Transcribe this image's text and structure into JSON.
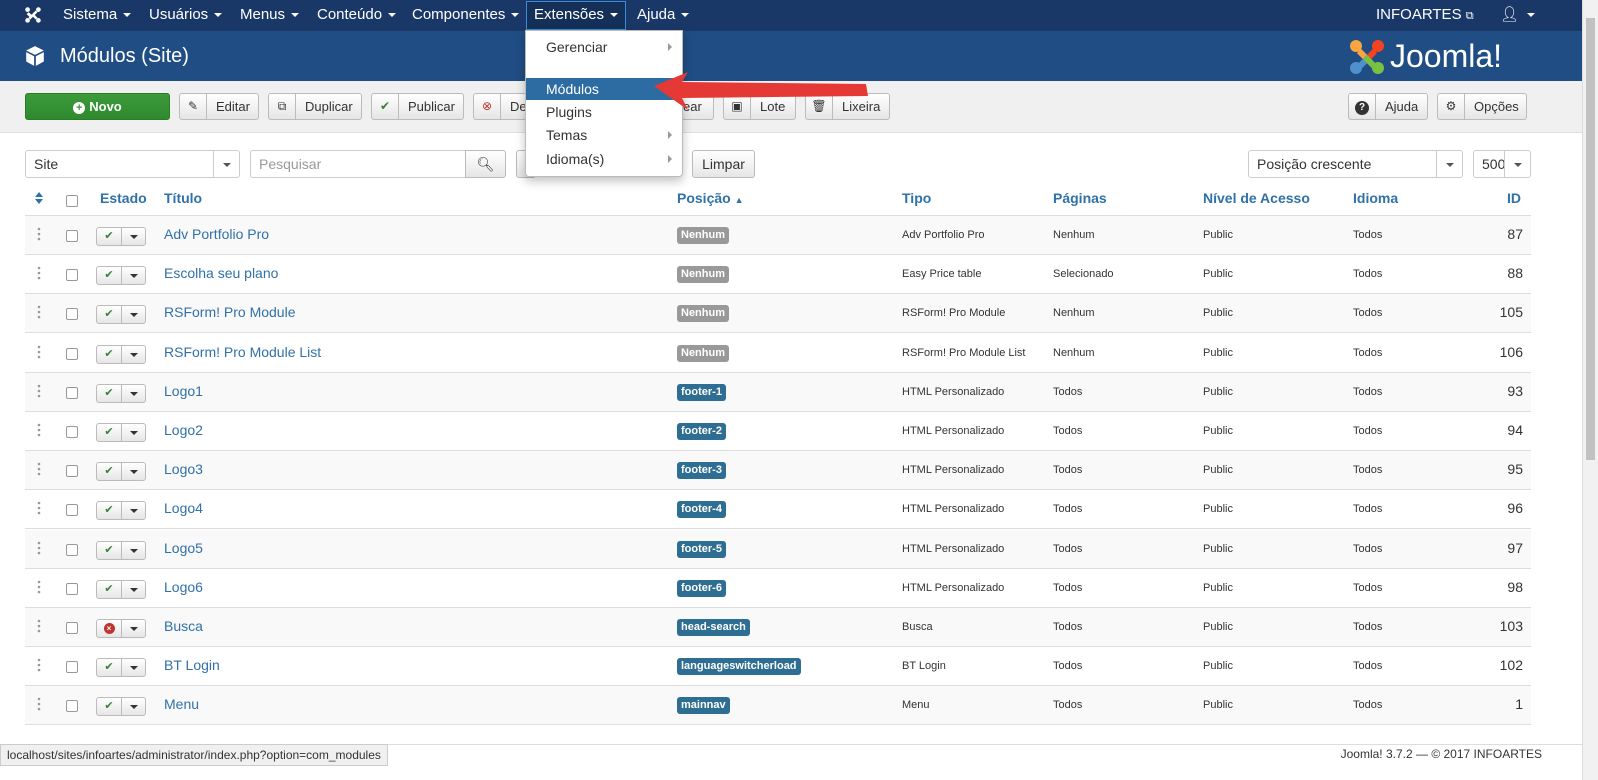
{
  "nav": {
    "items": [
      {
        "label": "Sistema"
      },
      {
        "label": "Usuários"
      },
      {
        "label": "Menus"
      },
      {
        "label": "Conteúdo"
      },
      {
        "label": "Componentes"
      },
      {
        "label": "Extensões"
      },
      {
        "label": "Ajuda"
      }
    ],
    "site_name": "INFOARTES"
  },
  "header": {
    "title": "Módulos (Site)",
    "logo_text": "Joomla!"
  },
  "toolbar": {
    "new": "Novo",
    "edit": "Editar",
    "duplicate": "Duplicar",
    "publish": "Publicar",
    "unpublish": "De",
    "checkin": "ear",
    "batch": "Lote",
    "trash": "Lixeira",
    "help": "Ajuda",
    "options": "Opções"
  },
  "dropdown": {
    "items": [
      {
        "label": "Gerenciar",
        "has_sub": true
      },
      {
        "label": "Módulos",
        "has_sub": false,
        "active": true
      },
      {
        "label": "Plugins",
        "has_sub": false
      },
      {
        "label": "Temas",
        "has_sub": true
      },
      {
        "label": "Idioma(s)",
        "has_sub": true
      }
    ]
  },
  "filters": {
    "client": "Site",
    "search_placeholder": "Pesquisar",
    "clear": "Limpar",
    "ordering": "Posição crescente",
    "limit": "500"
  },
  "table": {
    "headers": {
      "state": "Estado",
      "title": "Título",
      "position": "Posição",
      "type": "Tipo",
      "pages": "Páginas",
      "access": "Nível de Acesso",
      "language": "Idioma",
      "id": "ID"
    },
    "rows": [
      {
        "title": "Adv Portfolio Pro",
        "published": true,
        "position": "Nenhum",
        "type": "Adv Portfolio Pro",
        "pages": "Nenhum",
        "access": "Public",
        "language": "Todos",
        "id": "87"
      },
      {
        "title": "Escolha seu plano",
        "published": true,
        "position": "Nenhum",
        "type": "Easy Price table",
        "pages": "Selecionado",
        "access": "Public",
        "language": "Todos",
        "id": "88"
      },
      {
        "title": "RSForm! Pro Module",
        "published": true,
        "position": "Nenhum",
        "type": "RSForm! Pro Module",
        "pages": "Nenhum",
        "access": "Public",
        "language": "Todos",
        "id": "105"
      },
      {
        "title": "RSForm! Pro Module List",
        "published": true,
        "position": "Nenhum",
        "type": "RSForm! Pro Module List",
        "pages": "Nenhum",
        "access": "Public",
        "language": "Todos",
        "id": "106"
      },
      {
        "title": "Logo1",
        "published": true,
        "position": "footer-1",
        "type": "HTML Personalizado",
        "pages": "Todos",
        "access": "Public",
        "language": "Todos",
        "id": "93"
      },
      {
        "title": "Logo2",
        "published": true,
        "position": "footer-2",
        "type": "HTML Personalizado",
        "pages": "Todos",
        "access": "Public",
        "language": "Todos",
        "id": "94"
      },
      {
        "title": "Logo3",
        "published": true,
        "position": "footer-3",
        "type": "HTML Personalizado",
        "pages": "Todos",
        "access": "Public",
        "language": "Todos",
        "id": "95"
      },
      {
        "title": "Logo4",
        "published": true,
        "position": "footer-4",
        "type": "HTML Personalizado",
        "pages": "Todos",
        "access": "Public",
        "language": "Todos",
        "id": "96"
      },
      {
        "title": "Logo5",
        "published": true,
        "position": "footer-5",
        "type": "HTML Personalizado",
        "pages": "Todos",
        "access": "Public",
        "language": "Todos",
        "id": "97"
      },
      {
        "title": "Logo6",
        "published": true,
        "position": "footer-6",
        "type": "HTML Personalizado",
        "pages": "Todos",
        "access": "Public",
        "language": "Todos",
        "id": "98"
      },
      {
        "title": "Busca",
        "published": false,
        "position": "head-search",
        "type": "Busca",
        "pages": "Todos",
        "access": "Public",
        "language": "Todos",
        "id": "103"
      },
      {
        "title": "BT Login",
        "published": true,
        "position": "languageswitcherload",
        "type": "BT Login",
        "pages": "Todos",
        "access": "Public",
        "language": "Todos",
        "id": "102"
      },
      {
        "title": "Menu",
        "published": true,
        "position": "mainnav",
        "type": "Menu",
        "pages": "Todos",
        "access": "Public",
        "language": "Todos",
        "id": "1"
      }
    ]
  },
  "status_bar": {
    "url": "localhost/sites/infoartes/administrator/index.php?option=com_modules",
    "footer": "Joomla! 3.7.2  —  © 2017 INFOARTES"
  },
  "colors": {
    "navbar": "#1a3867",
    "header": "#1f4d84",
    "badge_none": "#999999",
    "badge_position": "#2f6e93",
    "link": "#3071a9",
    "new_button": "#3d9b3c",
    "arrow": "#e53935"
  }
}
